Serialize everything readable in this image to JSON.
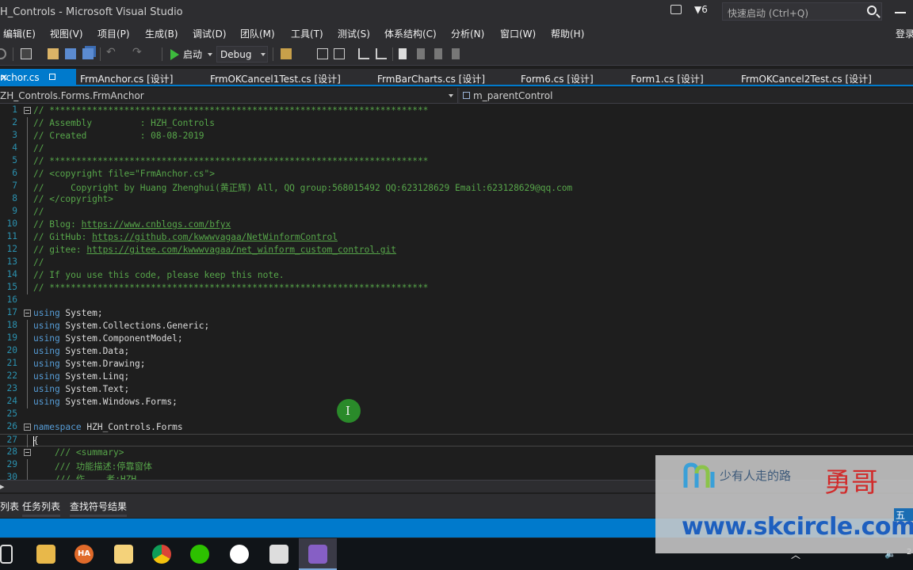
{
  "window": {
    "title": "H_Controls - Microsoft Visual Studio",
    "filter_count": "6",
    "quick_launch_placeholder": "快速启动 (Ctrl+Q)",
    "login": "登录"
  },
  "menu": [
    "编辑(E)",
    "视图(V)",
    "项目(P)",
    "生成(B)",
    "调试(D)",
    "团队(M)",
    "工具(T)",
    "测试(S)",
    "体系结构(C)",
    "分析(N)",
    "窗口(W)",
    "帮助(H)"
  ],
  "toolbar": {
    "start_label": "启动",
    "config": "Debug"
  },
  "tabs": {
    "active": "nchor.cs",
    "others": [
      "FrmAnchor.cs [设计]",
      "FrmOKCancel1Test.cs [设计]",
      "FrmBarCharts.cs [设计]",
      "Form6.cs [设计]",
      "Form1.cs [设计]",
      "FrmOKCancel2Test.cs [设计]"
    ]
  },
  "navbar": {
    "left": "ZH_Controls.Forms.FrmAnchor",
    "right": "m_parentControl"
  },
  "code": {
    "lines": [
      {
        "n": "1",
        "t": "// ***********************************************************************"
      },
      {
        "n": "2",
        "t": "// Assembly         : HZH_Controls"
      },
      {
        "n": "3",
        "t": "// Created          : 08-08-2019"
      },
      {
        "n": "4",
        "t": "//"
      },
      {
        "n": "5",
        "t": "// ***********************************************************************"
      },
      {
        "n": "6",
        "t": "// <copyright file=\"FrmAnchor.cs\">"
      },
      {
        "n": "7",
        "t": "//     Copyright by Huang Zhenghui(黄正辉) All, QQ group:568015492 QQ:623128629 Email:623128629@qq.com"
      },
      {
        "n": "8",
        "t": "// </copyright>"
      },
      {
        "n": "9",
        "t": "//"
      },
      {
        "n": "10",
        "t": "// Blog: ",
        "u": "https://www.cnblogs.com/bfyx"
      },
      {
        "n": "11",
        "t": "// GitHub: ",
        "u": "https://github.com/kwwwvagaa/NetWinformControl"
      },
      {
        "n": "12",
        "t": "// gitee: ",
        "u": "https://gitee.com/kwwwvagaa/net_winform_custom_control.git"
      },
      {
        "n": "13",
        "t": "//"
      },
      {
        "n": "14",
        "t": "// If you use this code, please keep this note."
      },
      {
        "n": "15",
        "t": "// ***********************************************************************"
      },
      {
        "n": "16",
        "t": ""
      },
      {
        "n": "17",
        "k": "using",
        "t": " System;"
      },
      {
        "n": "18",
        "k": "using",
        "t": " System.Collections.Generic;"
      },
      {
        "n": "19",
        "k": "using",
        "t": " System.ComponentModel;"
      },
      {
        "n": "20",
        "k": "using",
        "t": " System.Data;"
      },
      {
        "n": "21",
        "k": "using",
        "t": " System.Drawing;"
      },
      {
        "n": "22",
        "k": "using",
        "t": " System.Linq;"
      },
      {
        "n": "23",
        "k": "using",
        "t": " System.Text;"
      },
      {
        "n": "24",
        "k": "using",
        "t": " System.Windows.Forms;"
      },
      {
        "n": "25",
        "t": ""
      },
      {
        "n": "26",
        "k": "namespace",
        "t": " HZH_Controls.Forms"
      },
      {
        "n": "27",
        "t": "{"
      },
      {
        "n": "28",
        "t": "    /// <summary>"
      },
      {
        "n": "29",
        "t": "    /// 功能描述:停靠窗体"
      },
      {
        "n": "30",
        "t": "    /// 作    者:HZH"
      }
    ]
  },
  "bottom_tabs": [
    "列表",
    "任务列表",
    "查找符号结果"
  ],
  "watermark": {
    "brand": "少有人走的路",
    "name": "勇哥",
    "url": "www.skcircle.com"
  },
  "tray": {
    "ime": "五"
  },
  "colors": {
    "accent": "#007acc",
    "comment": "#57a64a",
    "keyword": "#569cd6",
    "line_number": "#2b91af"
  }
}
